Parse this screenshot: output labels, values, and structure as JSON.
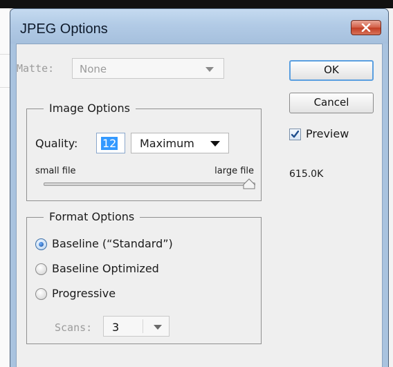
{
  "dialog": {
    "title": "JPEG Options",
    "close_icon": "close-x-icon"
  },
  "matte": {
    "label": "Matte:",
    "value": "None",
    "enabled": false
  },
  "buttons": {
    "ok": "OK",
    "cancel": "Cancel"
  },
  "preview": {
    "label": "Preview",
    "checked": true
  },
  "file_size": "615.0K",
  "image_options": {
    "title": "Image Options",
    "quality_label": "Quality:",
    "quality_value": "12",
    "quality_preset": "Maximum",
    "small_file_label": "small file",
    "large_file_label": "large file",
    "slider_level": 1.0
  },
  "format_options": {
    "title": "Format Options",
    "options": [
      {
        "label": "Baseline (“Standard”)",
        "selected": true
      },
      {
        "label": "Baseline Optimized",
        "selected": false
      },
      {
        "label": "Progressive",
        "selected": false
      }
    ],
    "scans_label": "Scans:",
    "scans_value": "3",
    "scans_enabled": false
  },
  "colors": {
    "title_bar": "#a9c3df",
    "close_button": "#c23d24",
    "selection": "#3399ff",
    "ok_focus": "#5a9fe0"
  }
}
